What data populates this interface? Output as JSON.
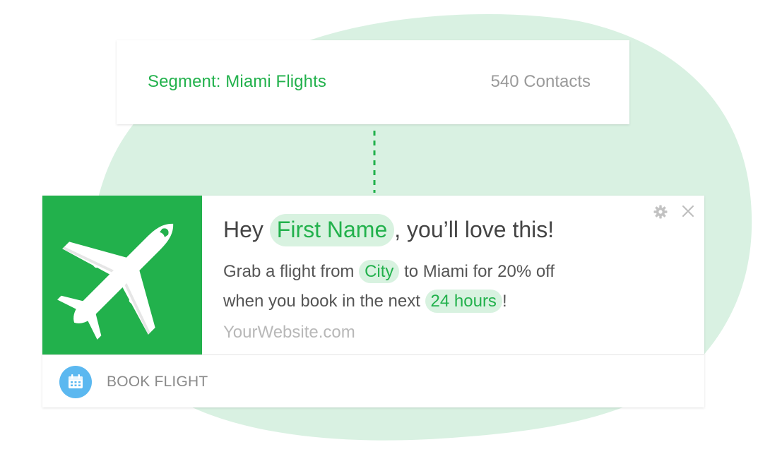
{
  "segment": {
    "label": "Segment: Miami Flights",
    "contacts": "540 Contacts"
  },
  "notification": {
    "icon": "airplane-icon",
    "headline": {
      "prefix": "Hey",
      "name_tag": "First Name",
      "suffix": ", you’ll love this!"
    },
    "message": {
      "part1": "Grab a flight from",
      "city_tag": "City",
      "part2": "to Miami for 20% off",
      "part3": "when you book in the next",
      "time_tag": "24 hours",
      "part4": "!"
    },
    "website": "YourWebsite.com",
    "action": {
      "icon": "calendar-icon",
      "label": "BOOK FLIGHT"
    },
    "controls": {
      "settings_icon": "gear-icon",
      "close_icon": "close-icon"
    }
  },
  "colors": {
    "brand_green": "#22b14c",
    "tag_background": "#d8f2e0",
    "blob": "#d9f1e2",
    "calendar_blue": "#5bb8f0"
  }
}
